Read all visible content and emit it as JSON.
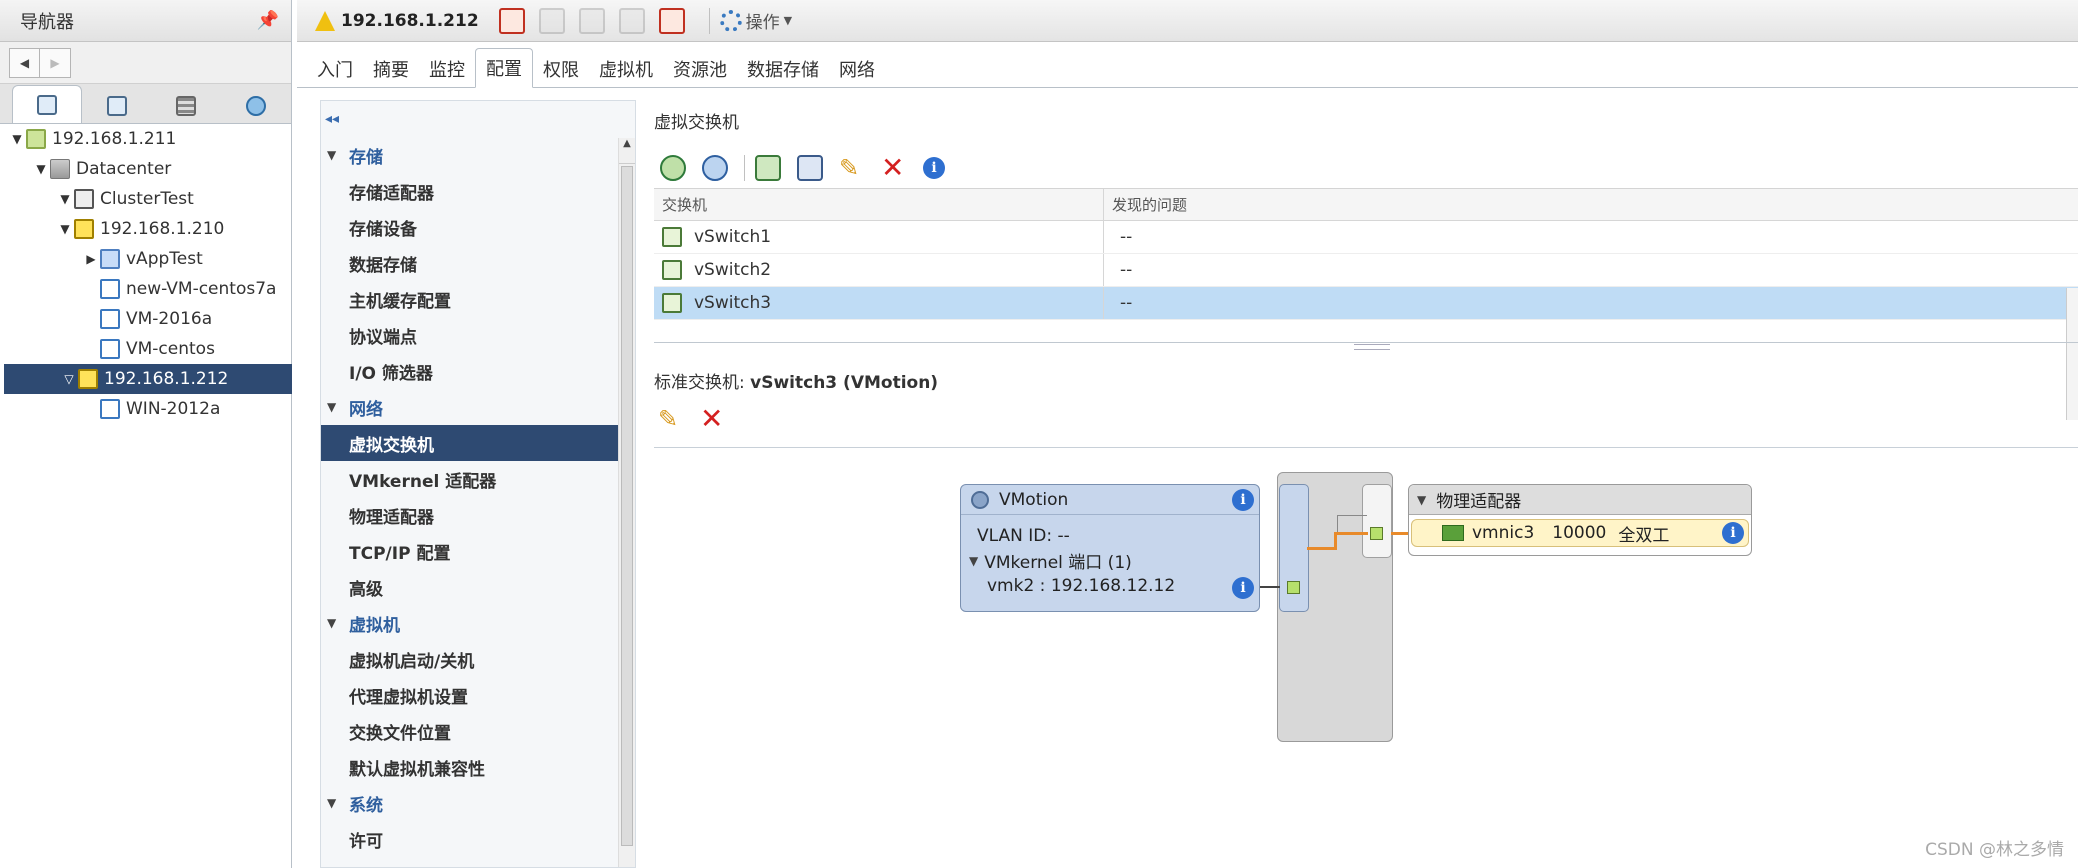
{
  "navigator": {
    "title": "导航器",
    "tree": [
      {
        "label": "192.168.1.211",
        "icon": "vcenter-icon",
        "expanded": true
      },
      {
        "label": "Datacenter",
        "icon": "datacenter-icon",
        "expanded": true
      },
      {
        "label": "ClusterTest",
        "icon": "cluster-icon",
        "expanded": true
      },
      {
        "label": "192.168.1.210",
        "icon": "host-warning-icon",
        "expanded": true
      },
      {
        "label": "vAppTest",
        "icon": "vapp-icon",
        "expanded": false
      },
      {
        "label": "new-VM-centos7a",
        "icon": "vm-icon"
      },
      {
        "label": "VM-2016a",
        "icon": "vm-icon"
      },
      {
        "label": "VM-centos",
        "icon": "vm-icon"
      },
      {
        "label": "192.168.1.212",
        "icon": "host-warning-icon",
        "expanded": true,
        "selected": true
      },
      {
        "label": "WIN-2012a",
        "icon": "vm-icon"
      }
    ]
  },
  "toolbar": {
    "object_title": "192.168.1.212",
    "actions_label": "操作"
  },
  "tabs": [
    "入门",
    "摘要",
    "监控",
    "配置",
    "权限",
    "虚拟机",
    "资源池",
    "数据存储",
    "网络"
  ],
  "active_tab": "配置",
  "settings_menu": {
    "groups": [
      {
        "label": "存储",
        "items": [
          "存储适配器",
          "存储设备",
          "数据存储",
          "主机缓存配置",
          "协议端点",
          "I/O 筛选器"
        ]
      },
      {
        "label": "网络",
        "items": [
          "虚拟交换机",
          "VMkernel 适配器",
          "物理适配器",
          "TCP/IP 配置",
          "高级"
        ]
      },
      {
        "label": "虚拟机",
        "items": [
          "虚拟机启动/关机",
          "代理虚拟机设置",
          "交换文件位置",
          "默认虚拟机兼容性"
        ]
      },
      {
        "label": "系统",
        "items": [
          "许可"
        ]
      }
    ],
    "selected_item": "虚拟交换机"
  },
  "virtual_switches": {
    "title": "虚拟交换机",
    "columns": [
      "交换机",
      "发现的问题"
    ],
    "rows": [
      {
        "name": "vSwitch1",
        "issues": "--"
      },
      {
        "name": "vSwitch2",
        "issues": "--"
      },
      {
        "name": "vSwitch3",
        "issues": "--",
        "selected": true
      }
    ]
  },
  "standard_switch": {
    "title_prefix": "标准交换机:",
    "title_name": "vSwitch3 (VMotion)",
    "port_group": {
      "name": "VMotion",
      "vlan": "VLAN ID: --",
      "vmkernel_ports": "VMkernel 端口 (1)",
      "vmk": "vmk2 : 192.168.12.12"
    },
    "physical_adapters": {
      "title": "物理适配器",
      "nic": "vmnic3",
      "speed": "10000",
      "duplex": "全双工"
    }
  },
  "watermark": "CSDN @林之多情"
}
